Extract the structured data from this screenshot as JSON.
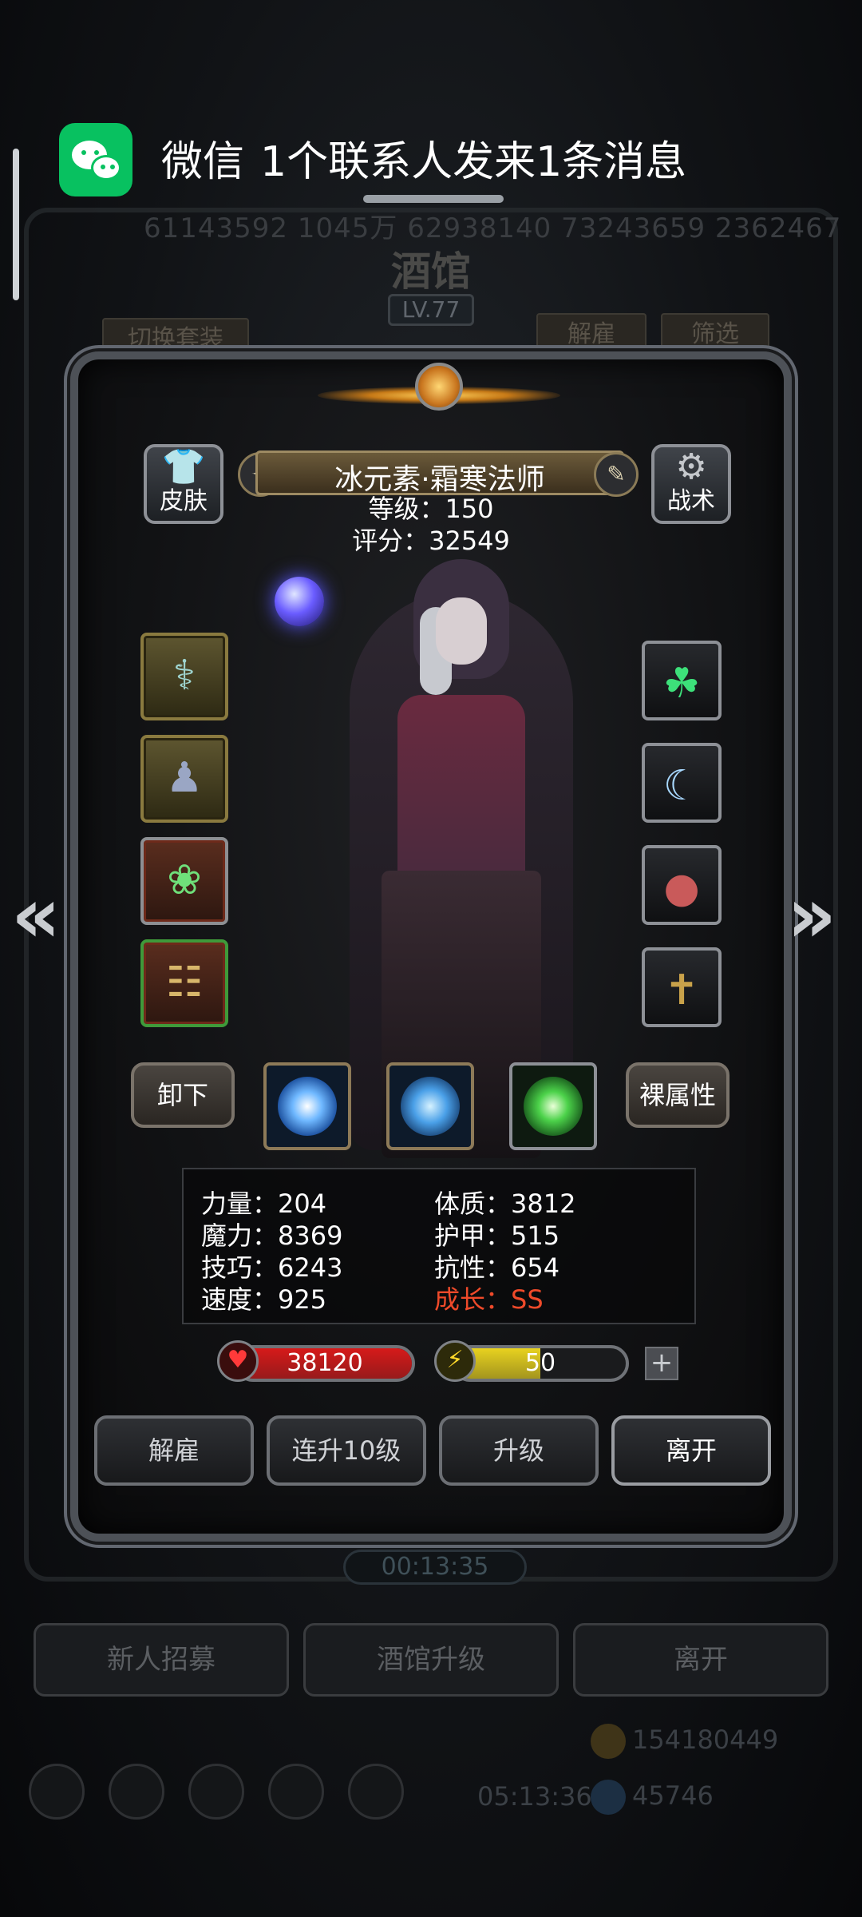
{
  "notification": {
    "app_name": "微信",
    "message": "1个联系人发来1条消息"
  },
  "background": {
    "numbers": "61143592  1045万  62938140  73243659  2362467",
    "title": "酒馆",
    "level": "LV.77",
    "tab_switch_outfit": "切换套装",
    "tab_dismiss": "解雇",
    "tab_filter": "筛选",
    "timer": "00:13:35",
    "buttons": [
      "新人招募",
      "酒馆升级",
      "离开"
    ],
    "gift_timer": "05:13:36",
    "gold": "154180449",
    "gems": "45746"
  },
  "hero": {
    "name": "冰元素·霜寒法师",
    "level_label": "等级：150",
    "score_label": "评分：32549",
    "skin_label": "皮肤",
    "tactics_label": "战术"
  },
  "actions": {
    "unequip": "卸下",
    "base_attributes": "裸属性"
  },
  "stats": [
    {
      "label": "力量：204"
    },
    {
      "label": "魔力：8369"
    },
    {
      "label": "技巧：6243"
    },
    {
      "label": "速度：925"
    },
    {
      "label": "体质：3812"
    },
    {
      "label": "护甲：515"
    },
    {
      "label": "抗性：654"
    },
    {
      "label": "成长：SS"
    }
  ],
  "hp": {
    "value": "38120",
    "fill": 1.0,
    "color": "#d61a1a"
  },
  "energy": {
    "value": "50",
    "fill": 0.5,
    "color": "#e8d21f"
  },
  "bottom_buttons": {
    "dismiss": "解雇",
    "level_up_10": "连升10级",
    "level_up": "升级",
    "leave": "离开"
  },
  "colors": {
    "growth_highlight": "#ef4a2a",
    "wechat_green": "#08c160"
  },
  "icons": {
    "left_equipment": [
      "staff-icon",
      "robe-icon",
      "amulet-icon",
      "spellbook-icon"
    ],
    "right_equipment": [
      "green-helm-icon",
      "crescent-moon-icon",
      "red-charm-icon",
      "golden-wand-icon"
    ],
    "skills": [
      "ice-shard-skill-icon",
      "frost-vortex-skill-icon",
      "green-flame-skill-icon"
    ]
  }
}
